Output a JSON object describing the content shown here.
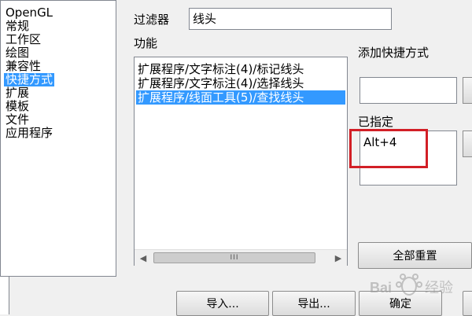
{
  "categories": {
    "items": [
      "OpenGL",
      "常规",
      "工作区",
      "绘图",
      "兼容性",
      "快捷方式",
      "扩展",
      "模板",
      "文件",
      "应用程序"
    ],
    "selected_index": 5
  },
  "filter": {
    "label": "过滤器",
    "value": "线头"
  },
  "functions": {
    "label": "功能",
    "items": [
      "扩展程序/文字标注(4)/标记线头",
      "扩展程序/文字标注(4)/选择线头",
      "扩展程序/线面工具(5)/查找线头"
    ],
    "selected_index": 2,
    "scroll_thumb": "III"
  },
  "add_shortcut": {
    "label": "添加快捷方式",
    "value": ""
  },
  "assigned": {
    "label": "已指定",
    "value": "Alt+4"
  },
  "buttons": {
    "reset_all": "全部重置",
    "import": "导入...",
    "export": "导出...",
    "ok": "确定"
  },
  "watermark": {
    "text": "Baidu经验"
  },
  "colors": {
    "selection": "#3399ff",
    "highlight_frame": "#d21f26"
  },
  "icons": {
    "scroll_left": "chevron-left-icon",
    "scroll_right": "chevron-right-icon"
  }
}
